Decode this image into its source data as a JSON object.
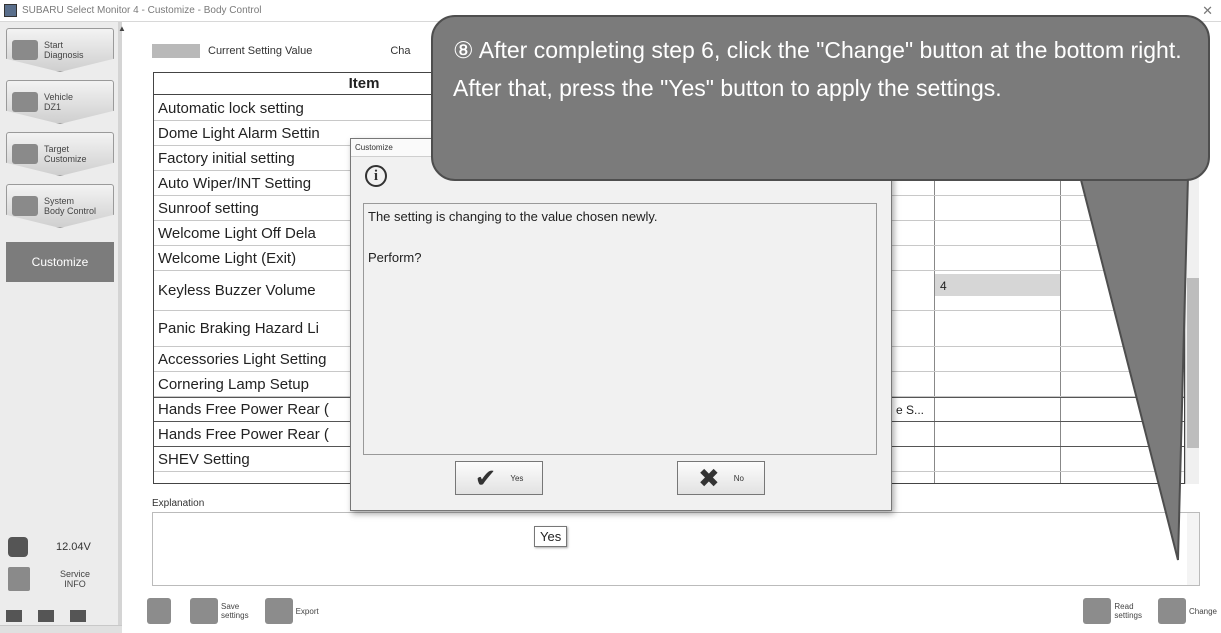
{
  "window": {
    "title": "SUBARU Select Monitor 4 - Customize - Body Control"
  },
  "sidebar": {
    "items": [
      {
        "label": "Start\nDiagnosis"
      },
      {
        "label": "Vehicle\nDZ1"
      },
      {
        "label": "Target\nCustomize"
      },
      {
        "label": "System\nBody Control"
      }
    ],
    "active": "Customize",
    "voltage": "12.04V",
    "service": "Service\nINFO"
  },
  "legend": {
    "current": "Current Setting Value",
    "changed": "Cha"
  },
  "table": {
    "header": "Item",
    "rows": [
      "Automatic lock setting",
      "Dome Light Alarm Settin",
      "Factory initial setting",
      "Auto Wiper/INT Setting",
      "Sunroof setting",
      "Welcome Light Off Dela",
      "Welcome Light (Exit)",
      "Keyless Buzzer Volume",
      "Panic Braking Hazard Li",
      "Accessories Light Setting",
      "Cornering Lamp Setup",
      "Hands Free Power Rear (",
      "Hands Free Power Rear (",
      "SHEV Setting"
    ],
    "keyless_value": "4",
    "hands_free_partial": "e S..."
  },
  "explanation": {
    "label": "Explanation",
    "tooltip": "Yes"
  },
  "toolbar": {
    "save": "Save\nsettings",
    "export": "Export",
    "read": "Read\nsettings",
    "change": "Change"
  },
  "dialog": {
    "title": "Customize",
    "message": "The setting is changing to the value chosen newly.",
    "question": "Perform?",
    "yes": "Yes",
    "no": "No"
  },
  "callout": {
    "text": "⑧ After completing step 6, click the \"Change\" button at the bottom right. After that, press the \"Yes\" button to apply the settings."
  },
  "colors": {
    "callout_bg": "#7b7b7b",
    "callout_border": "#4e4e4e",
    "active_sidebar": "#7c7c7c"
  }
}
